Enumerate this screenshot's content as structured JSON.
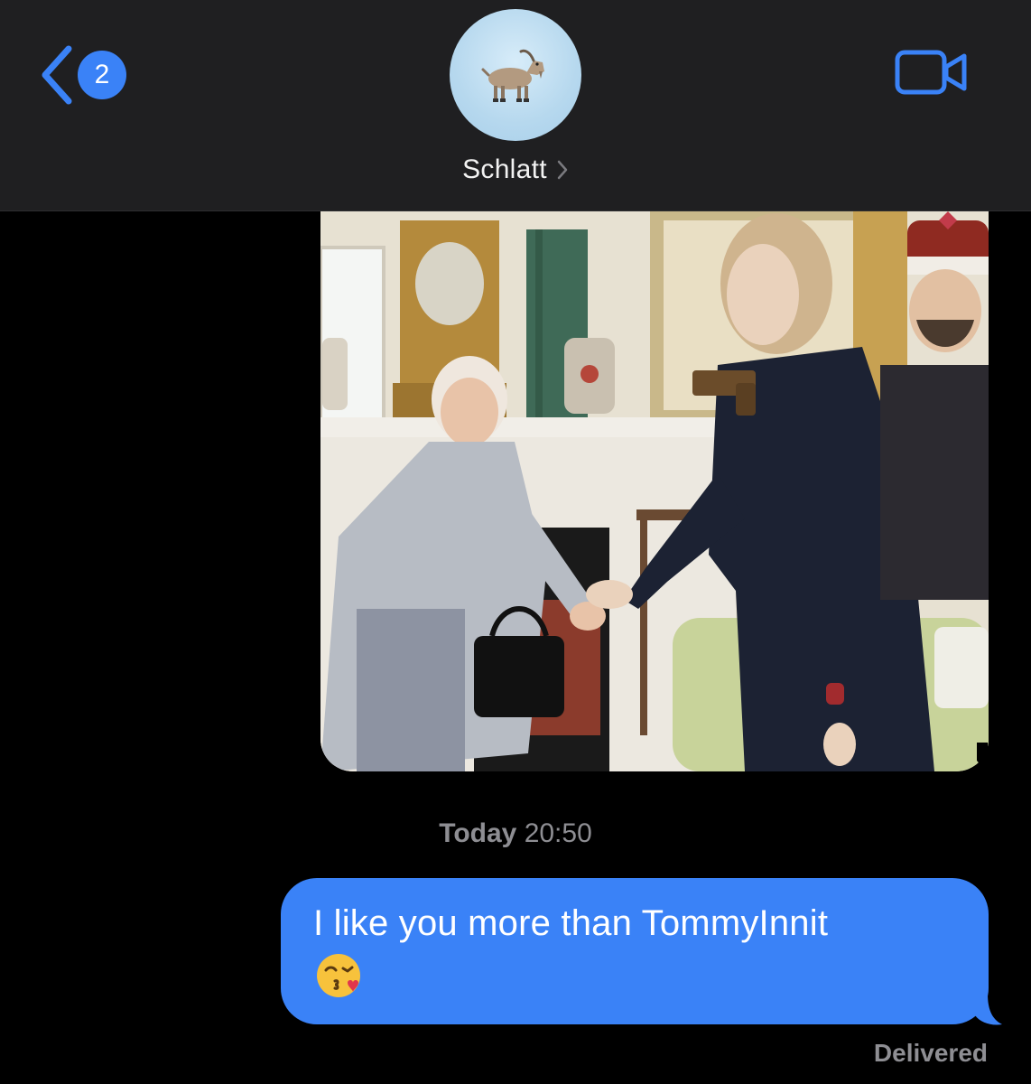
{
  "header": {
    "back_badge": "2",
    "contact_name": "Schlatt",
    "avatar_icon": "goat-emoji-icon",
    "video_icon": "video-camera-icon",
    "accent_color": "#3a82f7"
  },
  "messages": {
    "photo_icon": "photo-attachment",
    "timestamp_day": "Today",
    "timestamp_time": "20:50",
    "text": "I like you more than TommyInnit",
    "emoji_icon": "kissing-face-with-heart-emoji",
    "bubble_color": "#3a82f7",
    "status": "Delivered"
  }
}
